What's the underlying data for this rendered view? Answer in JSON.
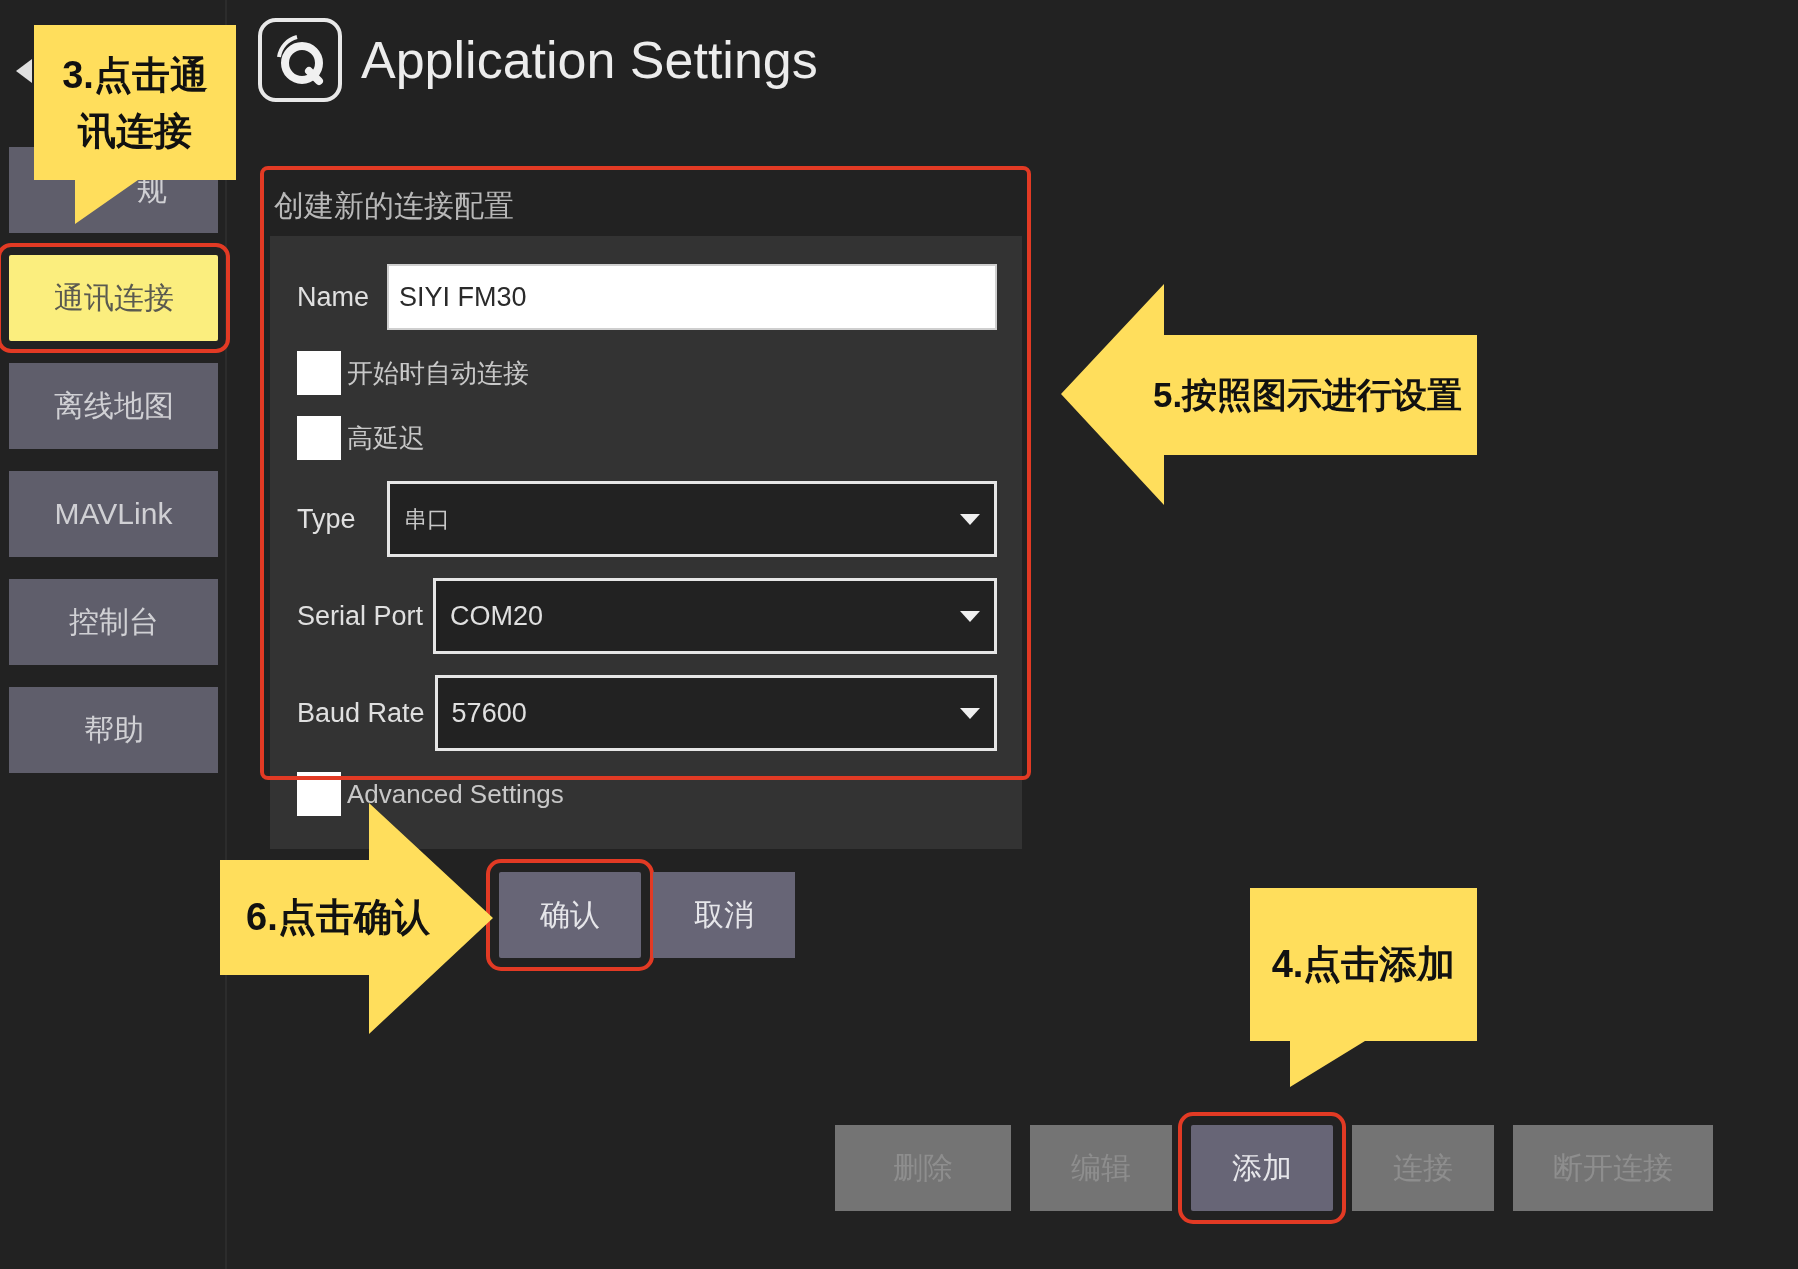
{
  "header": {
    "title": "Application Settings"
  },
  "sidebar": {
    "items": [
      {
        "label": "规",
        "selected": false,
        "highlighted": false
      },
      {
        "label": "通讯连接",
        "selected": true,
        "highlighted": true
      },
      {
        "label": "离线地图",
        "selected": false,
        "highlighted": false
      },
      {
        "label": "MAVLink",
        "selected": false,
        "highlighted": false
      },
      {
        "label": "控制台",
        "selected": false,
        "highlighted": false
      },
      {
        "label": "帮助",
        "selected": false,
        "highlighted": false
      }
    ]
  },
  "form": {
    "title": "创建新的连接配置",
    "highlighted": true,
    "fields": [
      {
        "kind": "text",
        "label": "Name",
        "value": "SIYI FM30"
      },
      {
        "kind": "checkbox",
        "label": "开始时自动连接",
        "checked": false
      },
      {
        "kind": "checkbox",
        "label": "高延迟",
        "checked": false
      },
      {
        "kind": "dropdown",
        "label": "Type",
        "value": "串口"
      },
      {
        "kind": "dropdown",
        "label": "Serial Port",
        "value": "COM20"
      },
      {
        "kind": "dropdown",
        "label": "Baud Rate",
        "value": "57600"
      },
      {
        "kind": "checkbox",
        "label": "Advanced Settings",
        "checked": false
      }
    ],
    "buttons": [
      {
        "label": "确认",
        "highlighted": true
      },
      {
        "label": "取消",
        "highlighted": false
      }
    ]
  },
  "actions": [
    {
      "label": "删除",
      "disabled": true,
      "highlighted": false
    },
    {
      "label": "编辑",
      "disabled": true,
      "highlighted": false
    },
    {
      "label": "添加",
      "disabled": false,
      "highlighted": true
    },
    {
      "label": "连接",
      "disabled": true,
      "highlighted": false
    },
    {
      "label": "断开连接",
      "disabled": true,
      "highlighted": false
    }
  ],
  "annotations": [
    {
      "kind": "callout",
      "text": "3.点击通讯连接"
    },
    {
      "kind": "callout",
      "text": "4.点击添加"
    },
    {
      "kind": "leftarrow",
      "text": "5.按照图示进行设置"
    },
    {
      "kind": "rightarrow",
      "text": "6.点击确认"
    }
  ]
}
